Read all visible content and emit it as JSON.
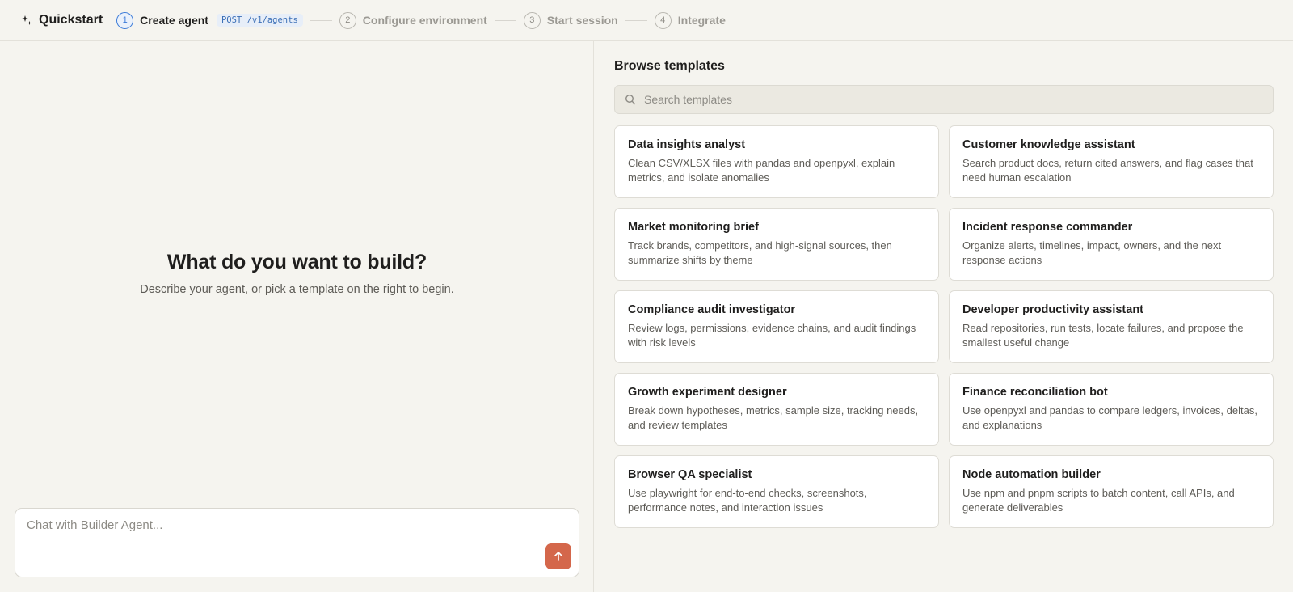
{
  "app": {
    "title": "Quickstart"
  },
  "steps": [
    {
      "number": "1",
      "label": "Create agent",
      "endpoint": "POST /v1/agents"
    },
    {
      "number": "2",
      "label": "Configure environment"
    },
    {
      "number": "3",
      "label": "Start session"
    },
    {
      "number": "4",
      "label": "Integrate"
    }
  ],
  "hero": {
    "title": "What do you want to build?",
    "subtitle": "Describe your agent, or pick a template on the right to begin."
  },
  "chat": {
    "placeholder": "Chat with Builder Agent..."
  },
  "browse": {
    "title": "Browse templates",
    "search_placeholder": "Search templates",
    "templates": [
      {
        "title": "Data insights analyst",
        "description": "Clean CSV/XLSX files with pandas and openpyxl, explain metrics, and isolate anomalies"
      },
      {
        "title": "Customer knowledge assistant",
        "description": "Search product docs, return cited answers, and flag cases that need human escalation"
      },
      {
        "title": "Market monitoring brief",
        "description": "Track brands, competitors, and high-signal sources, then summarize shifts by theme"
      },
      {
        "title": "Incident response commander",
        "description": "Organize alerts, timelines, impact, owners, and the next response actions"
      },
      {
        "title": "Compliance audit investigator",
        "description": "Review logs, permissions, evidence chains, and audit findings with risk levels"
      },
      {
        "title": "Developer productivity assistant",
        "description": "Read repositories, run tests, locate failures, and propose the smallest useful change"
      },
      {
        "title": "Growth experiment designer",
        "description": "Break down hypotheses, metrics, sample size, tracking needs, and review templates"
      },
      {
        "title": "Finance reconciliation bot",
        "description": "Use openpyxl and pandas to compare ledgers, invoices, deltas, and explanations"
      },
      {
        "title": "Browser QA specialist",
        "description": "Use playwright for end-to-end checks, screenshots, performance notes, and interaction issues"
      },
      {
        "title": "Node automation builder",
        "description": "Use npm and pnpm scripts to batch content, call APIs, and generate deliverables"
      }
    ]
  },
  "colors": {
    "background": "#f5f4ef",
    "accent": "#d4674b",
    "active_step": "#3b7bd8"
  }
}
